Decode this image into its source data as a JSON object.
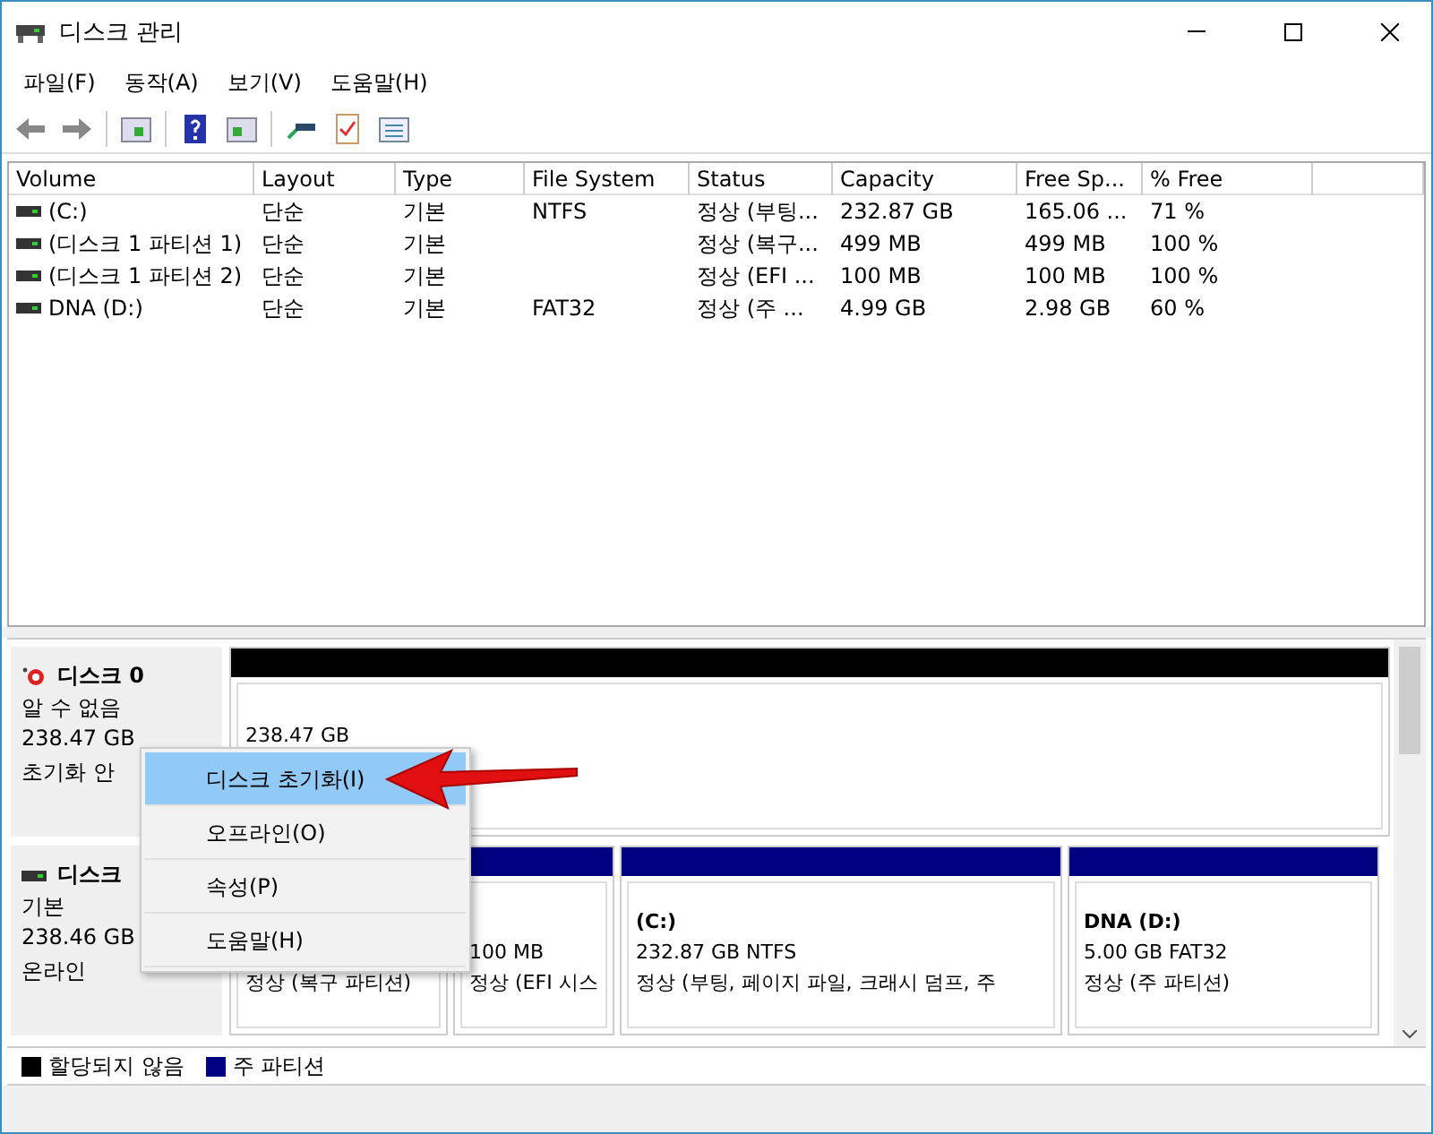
{
  "window": {
    "title": "디스크 관리"
  },
  "menu_bar": [
    "파일(F)",
    "동작(A)",
    "보기(V)",
    "도움말(H)"
  ],
  "volumes": {
    "columns": [
      "Volume",
      "Layout",
      "Type",
      "File System",
      "Status",
      "Capacity",
      "Free Sp...",
      "% Free"
    ],
    "rows": [
      [
        "(C:)",
        "단순",
        "기본",
        "NTFS",
        "정상 (부팅...",
        "232.87 GB",
        "165.06 ...",
        "71 %"
      ],
      [
        "(디스크 1 파티션 1)",
        "단순",
        "기본",
        "",
        "정상 (복구...",
        "499 MB",
        "499 MB",
        "100 %"
      ],
      [
        "(디스크 1 파티션 2)",
        "단순",
        "기본",
        "",
        "정상 (EFI ...",
        "100 MB",
        "100 MB",
        "100 %"
      ],
      [
        "DNA (D:)",
        "단순",
        "기본",
        "FAT32",
        "정상 (주 ...",
        "4.99 GB",
        "2.98 GB",
        "60 %"
      ]
    ]
  },
  "disks": [
    {
      "kind": "unknown",
      "name": "디스크 0",
      "type": "알 수 없음",
      "size": "238.47 GB",
      "status": "초기화 안",
      "partitions": [
        {
          "kind": "unallocated",
          "size": "238.47 GB"
        }
      ]
    },
    {
      "kind": "basic",
      "name": "디스크",
      "type": "기본",
      "size": "238.46 GB",
      "status": "온라인",
      "partitions": [
        {
          "kind": "primary",
          "state": "정상 (복구 파티션)"
        },
        {
          "kind": "primary",
          "size": "100 MB",
          "state": "정상 (EFI 시스"
        },
        {
          "kind": "primary",
          "title": "(C:)",
          "size": "232.87 GB NTFS",
          "state": "정상 (부팅, 페이지 파일, 크래시 덤프, 주"
        },
        {
          "kind": "primary",
          "title": "DNA   (D:)",
          "size": "5.00 GB FAT32",
          "state": "정상 (주 파티션)"
        }
      ]
    }
  ],
  "context_menu": [
    {
      "label": "디스크 초기화(I)",
      "selected": true
    },
    {
      "label": "오프라인(O)",
      "selected": false
    },
    {
      "label": "속성(P)",
      "selected": false
    },
    {
      "label": "도움말(H)",
      "selected": false
    }
  ],
  "legend": [
    {
      "label": "할당되지 않음",
      "color": "#000000"
    },
    {
      "label": "주 파티션",
      "color": "#000080"
    }
  ]
}
